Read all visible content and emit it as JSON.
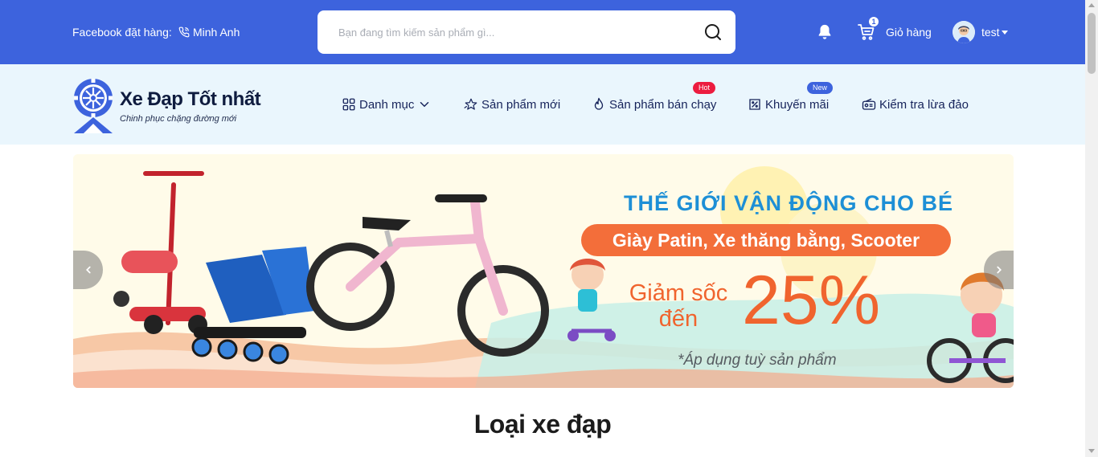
{
  "topbar": {
    "facebook_label": "Facebook đặt hàng:",
    "phone_label": "Minh Anh",
    "search_placeholder": "Bạn đang tìm kiếm sản phẩm gì...",
    "cart_count": "1",
    "cart_label": "Giỏ hàng",
    "user_name": "test"
  },
  "brand": {
    "name": "Xe Đạp Tốt nhất",
    "tagline": "Chinh phục chặng đường mới"
  },
  "nav": {
    "categories": "Danh mục",
    "new_products": "Sản phẩm mới",
    "best_sellers": "Sản phẩm bán chạy",
    "best_sellers_badge": "Hot",
    "promotions": "Khuyến mãi",
    "promotions_badge": "New",
    "fraud_check": "Kiểm tra lừa đảo"
  },
  "banner": {
    "title": "THẾ GIỚI VẬN ĐỘNG CHO BÉ",
    "subtitle": "Giày Patin, Xe thăng bằng, Scooter",
    "sale_label": "Giảm sốc đến",
    "sale_percent": "25%",
    "note": "*Áp dụng tuỳ sản phẩm"
  },
  "section": {
    "title": "Loại xe đạp"
  },
  "icons": {
    "phone": "phone-icon",
    "search": "search-icon",
    "bell": "bell-icon",
    "cart": "cart-icon",
    "categories": "grid-icon",
    "new": "star-icon",
    "best": "flame-icon",
    "promo": "discount-icon",
    "fraud": "radio-icon"
  },
  "colors": {
    "primary": "#3d63dd",
    "nav_bg": "#eaf6fd",
    "hot": "#ec1c3f",
    "promo_orange": "#f36e3a",
    "promo_blue": "#1d8fd6"
  }
}
